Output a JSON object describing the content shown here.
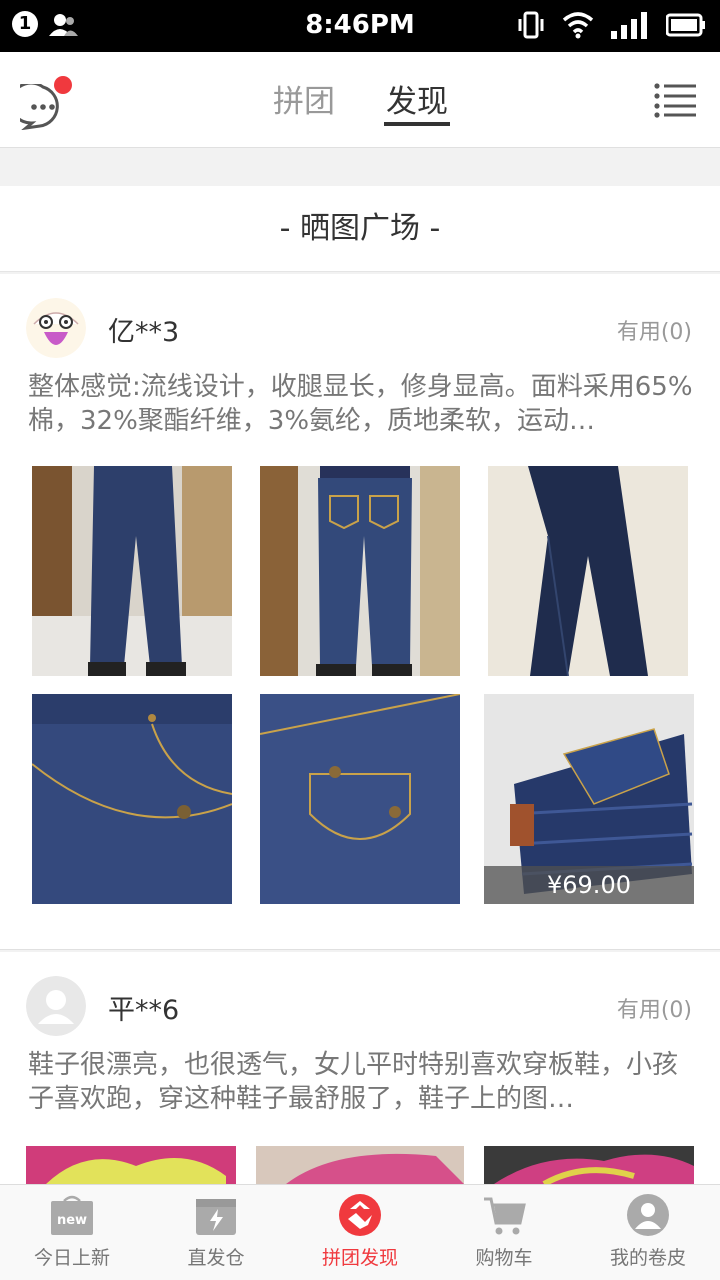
{
  "status_bar": {
    "notification_count": "1",
    "time": "8:46PM"
  },
  "top_nav": {
    "tabs": [
      {
        "label": "拼团",
        "active": false
      },
      {
        "label": "发现",
        "active": true
      }
    ]
  },
  "section": {
    "title": "- 晒图广场 -"
  },
  "posts": [
    {
      "username": "亿**3",
      "useful": "有用(0)",
      "content": "整体感觉:流线设计，收腿显长，修身显高。面料采用65%棉，32%聚酯纤维，3%氨纶，质地柔软，运动…",
      "price_tag": "¥69.00"
    },
    {
      "username": "平**6",
      "useful": "有用(0)",
      "content": "鞋子很漂亮，也很透气，女儿平时特别喜欢穿板鞋，小孩子喜欢跑，穿这种鞋子最舒服了，鞋子上的图…"
    }
  ],
  "tab_bar": {
    "items": [
      {
        "label": "今日上新",
        "icon": "new-bag-icon",
        "badge": "new"
      },
      {
        "label": "直发仓",
        "icon": "warehouse-icon"
      },
      {
        "label": "拼团发现",
        "icon": "group-discover-icon",
        "active": true
      },
      {
        "label": "购物车",
        "icon": "cart-icon"
      },
      {
        "label": "我的卷皮",
        "icon": "profile-icon"
      }
    ]
  },
  "colors": {
    "accent_red": "#f0393e",
    "denim_dark": "#23335c",
    "denim_mid": "#3a5083"
  }
}
